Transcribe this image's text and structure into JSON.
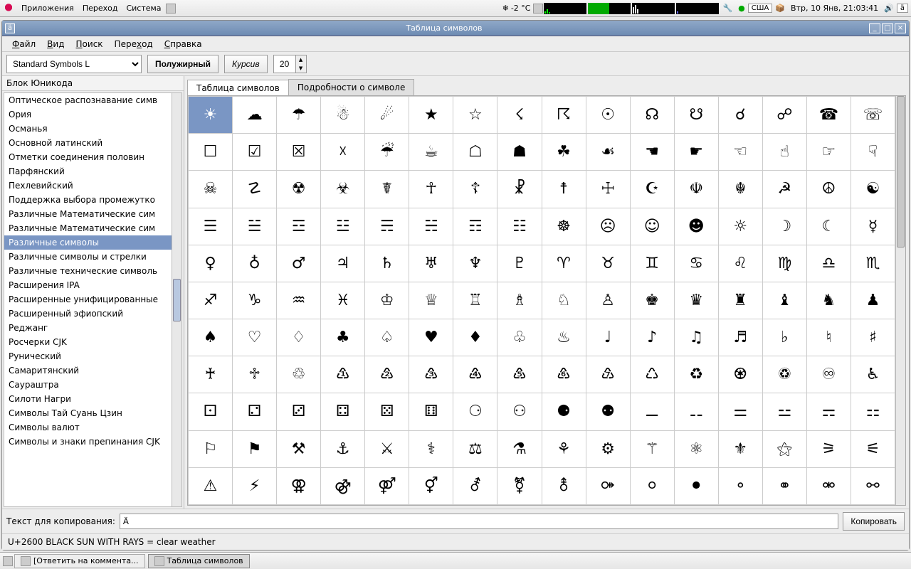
{
  "top_panel": {
    "menus": [
      "Приложения",
      "Переход",
      "Система"
    ],
    "weather_temp": "-2 °C",
    "keyboard": "США",
    "clock": "Втр, 10 Янв, 21:03:41",
    "kbd_indicator": "ä"
  },
  "window": {
    "title": "Таблица символов",
    "menu_icon": "ä",
    "menubar": [
      {
        "u": "Ф",
        "rest": "айл"
      },
      {
        "u": "В",
        "rest": "ид"
      },
      {
        "u": "П",
        "rest": "оиск"
      },
      {
        "u": "",
        "rest": "Пере",
        "u2": "х",
        "rest2": "од"
      },
      {
        "u": "С",
        "rest": "правка"
      }
    ],
    "font_select": "Standard Symbols L",
    "bold_btn": "Полужирный",
    "italic_btn": "Курсив",
    "size_value": "20",
    "sidebar_header": "Блок Юникода",
    "sidebar_items": [
      "Оптическое распознавание симв",
      "Ория",
      "Османья",
      "Основной латинский",
      "Отметки соединения половин",
      "Парфянский",
      "Пехлевийский",
      "Поддержка выбора промежутко",
      "Различные Математические сим",
      "Различные Математические сим",
      "Различные символы",
      "Различные символы и стрелки",
      "Различные технические символь",
      "Расширения IPA",
      "Расширенные унифицированные",
      "Расширенный эфиопский",
      "Реджанг",
      "Росчерки CJK",
      "Рунический",
      "Самаритянский",
      "Саураштра",
      "Силоти Нагри",
      "Символы Тай Суань Цзин",
      "Символы валют",
      "Символы и знаки препинания CJK"
    ],
    "sidebar_selected": 10,
    "tabs": [
      "Таблица символов",
      "Подробности о символе"
    ],
    "active_tab": 0,
    "grid": [
      [
        "☀",
        "☁",
        "☂",
        "☃",
        "☄",
        "★",
        "☆",
        "☇",
        "☈",
        "☉",
        "☊",
        "☋",
        "☌",
        "☍",
        "☎",
        "☏"
      ],
      [
        "☐",
        "☑",
        "☒",
        "☓",
        "☔",
        "☕",
        "☖",
        "☗",
        "☘",
        "☙",
        "☚",
        "☛",
        "☜",
        "☝",
        "☞",
        "☟"
      ],
      [
        "☠",
        "☡",
        "☢",
        "☣",
        "☤",
        "☥",
        "☦",
        "☧",
        "☨",
        "☩",
        "☪",
        "☫",
        "☬",
        "☭",
        "☮",
        "☯"
      ],
      [
        "☰",
        "☱",
        "☲",
        "☳",
        "☴",
        "☵",
        "☶",
        "☷",
        "☸",
        "☹",
        "☺",
        "☻",
        "☼",
        "☽",
        "☾",
        "☿"
      ],
      [
        "♀",
        "♁",
        "♂",
        "♃",
        "♄",
        "♅",
        "♆",
        "♇",
        "♈",
        "♉",
        "♊",
        "♋",
        "♌",
        "♍",
        "♎",
        "♏"
      ],
      [
        "♐",
        "♑",
        "♒",
        "♓",
        "♔",
        "♕",
        "♖",
        "♗",
        "♘",
        "♙",
        "♚",
        "♛",
        "♜",
        "♝",
        "♞",
        "♟"
      ],
      [
        "♠",
        "♡",
        "♢",
        "♣",
        "♤",
        "♥",
        "♦",
        "♧",
        "♨",
        "♩",
        "♪",
        "♫",
        "♬",
        "♭",
        "♮",
        "♯"
      ],
      [
        "♰",
        "♱",
        "♲",
        "♳",
        "♴",
        "♵",
        "♶",
        "♷",
        "♸",
        "♹",
        "♺",
        "♻",
        "♼",
        "♽",
        "♾",
        "♿"
      ],
      [
        "⚀",
        "⚁",
        "⚂",
        "⚃",
        "⚄",
        "⚅",
        "⚆",
        "⚇",
        "⚈",
        "⚉",
        "⚊",
        "⚋",
        "⚌",
        "⚍",
        "⚎",
        "⚏"
      ],
      [
        "⚐",
        "⚑",
        "⚒",
        "⚓",
        "⚔",
        "⚕",
        "⚖",
        "⚗",
        "⚘",
        "⚙",
        "⚚",
        "⚛",
        "⚜",
        "⚝",
        "⚞",
        "⚟"
      ],
      [
        "⚠",
        "⚡",
        "⚢",
        "⚣",
        "⚤",
        "⚥",
        "⚦",
        "⚧",
        "⚨",
        "⚩",
        "⚪",
        "⚫",
        "⚬",
        "⚭",
        "⚮",
        "⚯"
      ]
    ],
    "selected_cell": [
      0,
      0
    ],
    "copy_label": "Текст для копирования:",
    "copy_value": "Ä",
    "copy_button": "Копировать",
    "status": "U+2600 BLACK SUN WITH RAYS   = clear weather"
  },
  "bottom_panel": {
    "tasks": [
      {
        "label": "[Ответить на коммента...",
        "active": false
      },
      {
        "label": "Таблица символов",
        "active": true
      }
    ]
  }
}
